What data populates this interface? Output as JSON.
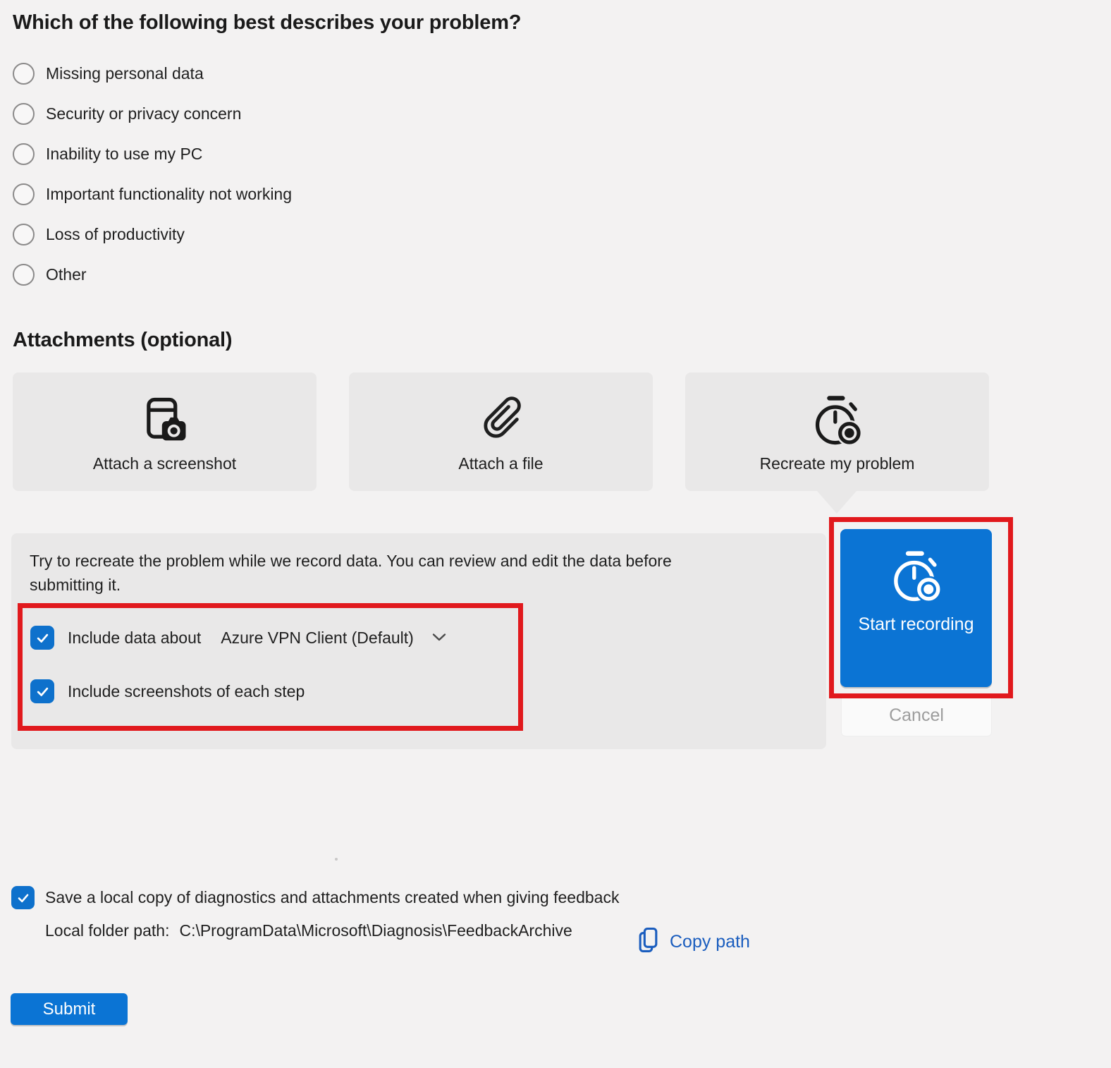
{
  "question": {
    "title": "Which of the following best describes your problem?",
    "options": [
      "Missing personal data",
      "Security or privacy concern",
      "Inability to use my PC",
      "Important functionality not working",
      "Loss of productivity",
      "Other"
    ]
  },
  "attachments": {
    "heading": "Attachments (optional)",
    "cards": [
      {
        "label": "Attach a screenshot",
        "icon": "screenshot-icon"
      },
      {
        "label": "Attach a file",
        "icon": "paperclip-icon"
      },
      {
        "label": "Recreate my problem",
        "icon": "stopwatch-icon"
      }
    ]
  },
  "recreate_panel": {
    "description": "Try to recreate the problem while we record data. You can review and edit the data before submitting it.",
    "include_data_label": "Include data about",
    "include_data_checked": true,
    "app_dropdown_value": "Azure VPN Client (Default)",
    "include_screenshots_label": "Include screenshots of each step",
    "include_screenshots_checked": true,
    "start_button_label": "Start recording",
    "cancel_button_label": "Cancel"
  },
  "footer": {
    "save_copy_label": "Save a local copy of diagnostics and attachments created when giving feedback",
    "save_copy_checked": true,
    "local_folder_label": "Local folder path:",
    "local_folder_path": "C:\\ProgramData\\Microsoft\\Diagnosis\\FeedbackArchive",
    "copy_path_label": "Copy path",
    "submit_label": "Submit"
  },
  "colors": {
    "accent_blue": "#0b74d4",
    "checkbox_blue": "#0e71cc",
    "link_blue": "#1a5dbe",
    "annotation_red": "#e1191d",
    "page_bg": "#f3f2f2",
    "card_bg": "#e9e8e8"
  }
}
